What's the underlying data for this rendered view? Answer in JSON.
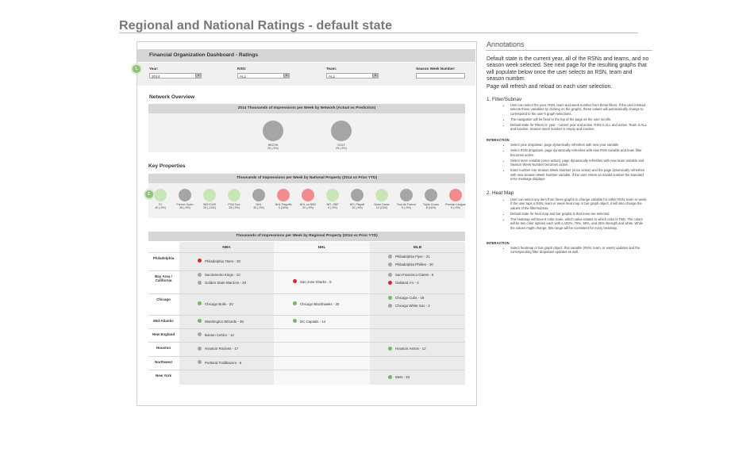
{
  "page": {
    "title": "Regional and National Ratings  - default state"
  },
  "dashboard": {
    "title": "Financial Organization Dashboard - Ratings",
    "step_markers": [
      "1.",
      "2."
    ],
    "filters": [
      {
        "label": "Year:",
        "value": "2014"
      },
      {
        "label": "RSN:",
        "value": "ALL"
      },
      {
        "label": "Team:",
        "value": "ALL"
      },
      {
        "label": "Season Week Number:",
        "value": ""
      }
    ]
  },
  "network_overview": {
    "title": "Network Overview",
    "chart_header": "2014 Thousands of Impressions per Week by Network (Actual vs Prediction)",
    "bubbles": [
      {
        "name": "NBCSN",
        "value": "25 (-9%)",
        "color": "#a5a5a5"
      },
      {
        "name": "GOLF",
        "value": "25 (-9%)",
        "color": "#a5a5a5"
      }
    ]
  },
  "key_properties": {
    "title": "Key Properties",
    "chart_header": "Thousands of Impressions per Week by National Property (2014 vs Prior YTD)",
    "bubbles": [
      {
        "name": "F1",
        "value": "40 (-9%)",
        "color": "#c9e6b7"
      },
      {
        "name": "French Open",
        "value": "35 (-9%)",
        "color": "#a5a5a5"
      },
      {
        "name": "INDYCAR",
        "value": "25 (-13%)",
        "color": "#c9e6b7"
      },
      {
        "name": "PGA Tour",
        "value": "35 (-9%)",
        "color": "#c9e6b7"
      },
      {
        "name": "NHL",
        "value": "30 (-9%)",
        "color": "#a5a5a5"
      },
      {
        "name": "NHL Playoffs",
        "value": "3 (16%)",
        "color": "#f08c8c"
      },
      {
        "name": "NHL on NBC",
        "value": "20 (-9%)",
        "color": "#f08c8c"
      },
      {
        "name": "NFL SNF",
        "value": "5 (-9%)",
        "color": "#c9e6b7"
      },
      {
        "name": "NFL Playoff",
        "value": "10 (-9%)",
        "color": "#a5a5a5"
      },
      {
        "name": "Notre Dame",
        "value": "10 (13%)",
        "color": "#c9e6b7"
      },
      {
        "name": "Tour de France",
        "value": "5 (-9%)",
        "color": "#a5a5a5"
      },
      {
        "name": "Triple Crown",
        "value": "8 (16%)",
        "color": "#a5a5a5"
      },
      {
        "name": "Premier League",
        "value": "5 (-9%)",
        "color": "#f08c8c"
      }
    ]
  },
  "regional": {
    "chart_header": "Thousands of Impressions per Week by Regional Property (2014 vs Prior YTD)",
    "columns": [
      "NBA",
      "NHL",
      "MLB"
    ],
    "rows": [
      {
        "region": "Philadelphia",
        "nba": [
          {
            "text": "Philadelphia 76ers  - 30",
            "color": "#d0283a"
          }
        ],
        "nhl": [],
        "mlb": [
          {
            "text": "Philadelphia Flyer  - 21",
            "color": "#a5a5a5"
          },
          {
            "text": "Philadelphia Phillies  - 20",
            "color": "#a5a5a5"
          }
        ]
      },
      {
        "region": "Bay Area / California",
        "nba": [
          {
            "text": "Sacramento Kings  - 10",
            "color": "#a5a5a5"
          },
          {
            "text": "Golden State Warriors  - 20",
            "color": "#a5a5a5"
          }
        ],
        "nhl": [
          {
            "text": "San Jose Sharks  - 5",
            "color": "#d0283a"
          }
        ],
        "mlb": [
          {
            "text": "San Francisco Giants  - 5",
            "color": "#a5a5a5"
          },
          {
            "text": "Oakland A's  - 4",
            "color": "#d0283a"
          }
        ]
      },
      {
        "region": "Chicago",
        "nba": [
          {
            "text": "Chicago Bulls  - 20",
            "color": "#79b85a"
          }
        ],
        "nhl": [
          {
            "text": "Chicago Blackhawks  - 30",
            "color": "#79b85a"
          }
        ],
        "mlb": [
          {
            "text": "Chicago Cubs  - 18",
            "color": "#79b85a"
          },
          {
            "text": "Chicago White Sox  - 2",
            "color": "#a5a5a5"
          }
        ]
      },
      {
        "region": "Mid-Atlantic",
        "nba": [
          {
            "text": "Washington Wizards  - 30",
            "color": "#79b85a"
          }
        ],
        "nhl": [
          {
            "text": "DC Capitals  - 14",
            "color": "#79b85a"
          }
        ],
        "mlb": []
      },
      {
        "region": "New England",
        "nba": [
          {
            "text": "Boston Celtics  - 12",
            "color": "#a5a5a5"
          }
        ],
        "nhl": [],
        "mlb": []
      },
      {
        "region": "Houston",
        "nba": [
          {
            "text": "Houston Rockets  - 17",
            "color": "#a5a5a5"
          }
        ],
        "nhl": [],
        "mlb": [
          {
            "text": "Houston Astros  - 12",
            "color": "#79b85a"
          }
        ]
      },
      {
        "region": "Northwest",
        "nba": [
          {
            "text": "Portland Trailblazers  - 5",
            "color": "#a5a5a5"
          }
        ],
        "nhl": [],
        "mlb": []
      },
      {
        "region": "New York",
        "nba": [],
        "nhl": [],
        "mlb": [
          {
            "text": "Mets  - 22",
            "color": "#79b85a"
          }
        ]
      }
    ]
  },
  "annotations": {
    "title": "Annotations",
    "intro": "Default state is the current year, all of the RSNs and teams, and no season week selected. See next page for the resulting graphs that will populate below once the user selects an RSN, team and season number.",
    "refresh": "Page will refresh and reload on each user selection.",
    "sections": [
      {
        "heading": "1.    Filter/Subnav",
        "bullets": [
          "User can select the year, RSN, team and week number from these filters. If the user instead selects these variables by clicking on the graphs, these values will automatically change to correspond to the user's graph selections.",
          "The navigation will be fixed to the top of the page as the user scrolls.",
          "Default state for Filters is: year - current year and active. RSN  is ALL and active. Team is ALL and inactive. Season week number is empty and inactive."
        ],
        "interaction_label": "INTERACTION",
        "interaction": [
          "Select year dropdown, page dynamically refreshes with new year variable",
          "Select RSN dropdown, page dynamically refreshes with new RSN variable and team filter becomes active.",
          "Select team variable (once active), page dynamically refreshes with new team variable and Season Week Number becomes active.",
          "Enter number into Season Week Number (once active) and the page dynamically refreshes with new Season Week Number variable. If the user enters an invalid number the standard error message displays."
        ]
      },
      {
        "heading": "2.    Heat Map",
        "bullets": [
          "User can select any item from these graphs to change variable for either RSN, team or week. If the user taps a RSN, team or week heat map or bar graph object, it will also change the values of the filter/subnav.",
          "Default state for heat map and bar graphs is that none are selected.",
          "The heatmap will have 9 color scale, which value relates to which color is TBD. The colors will be two color options each with a 100%, 75%, 50%, and 25% strength and white. While the values might change, this range will be consistent for every heatmap."
        ],
        "interaction_label": "INTERACTION",
        "interaction": [
          "Select heatmap  or bar graph object, that variable (RSN, team, or week) updates and the corresponding filter dropdown updates as well."
        ]
      }
    ]
  }
}
